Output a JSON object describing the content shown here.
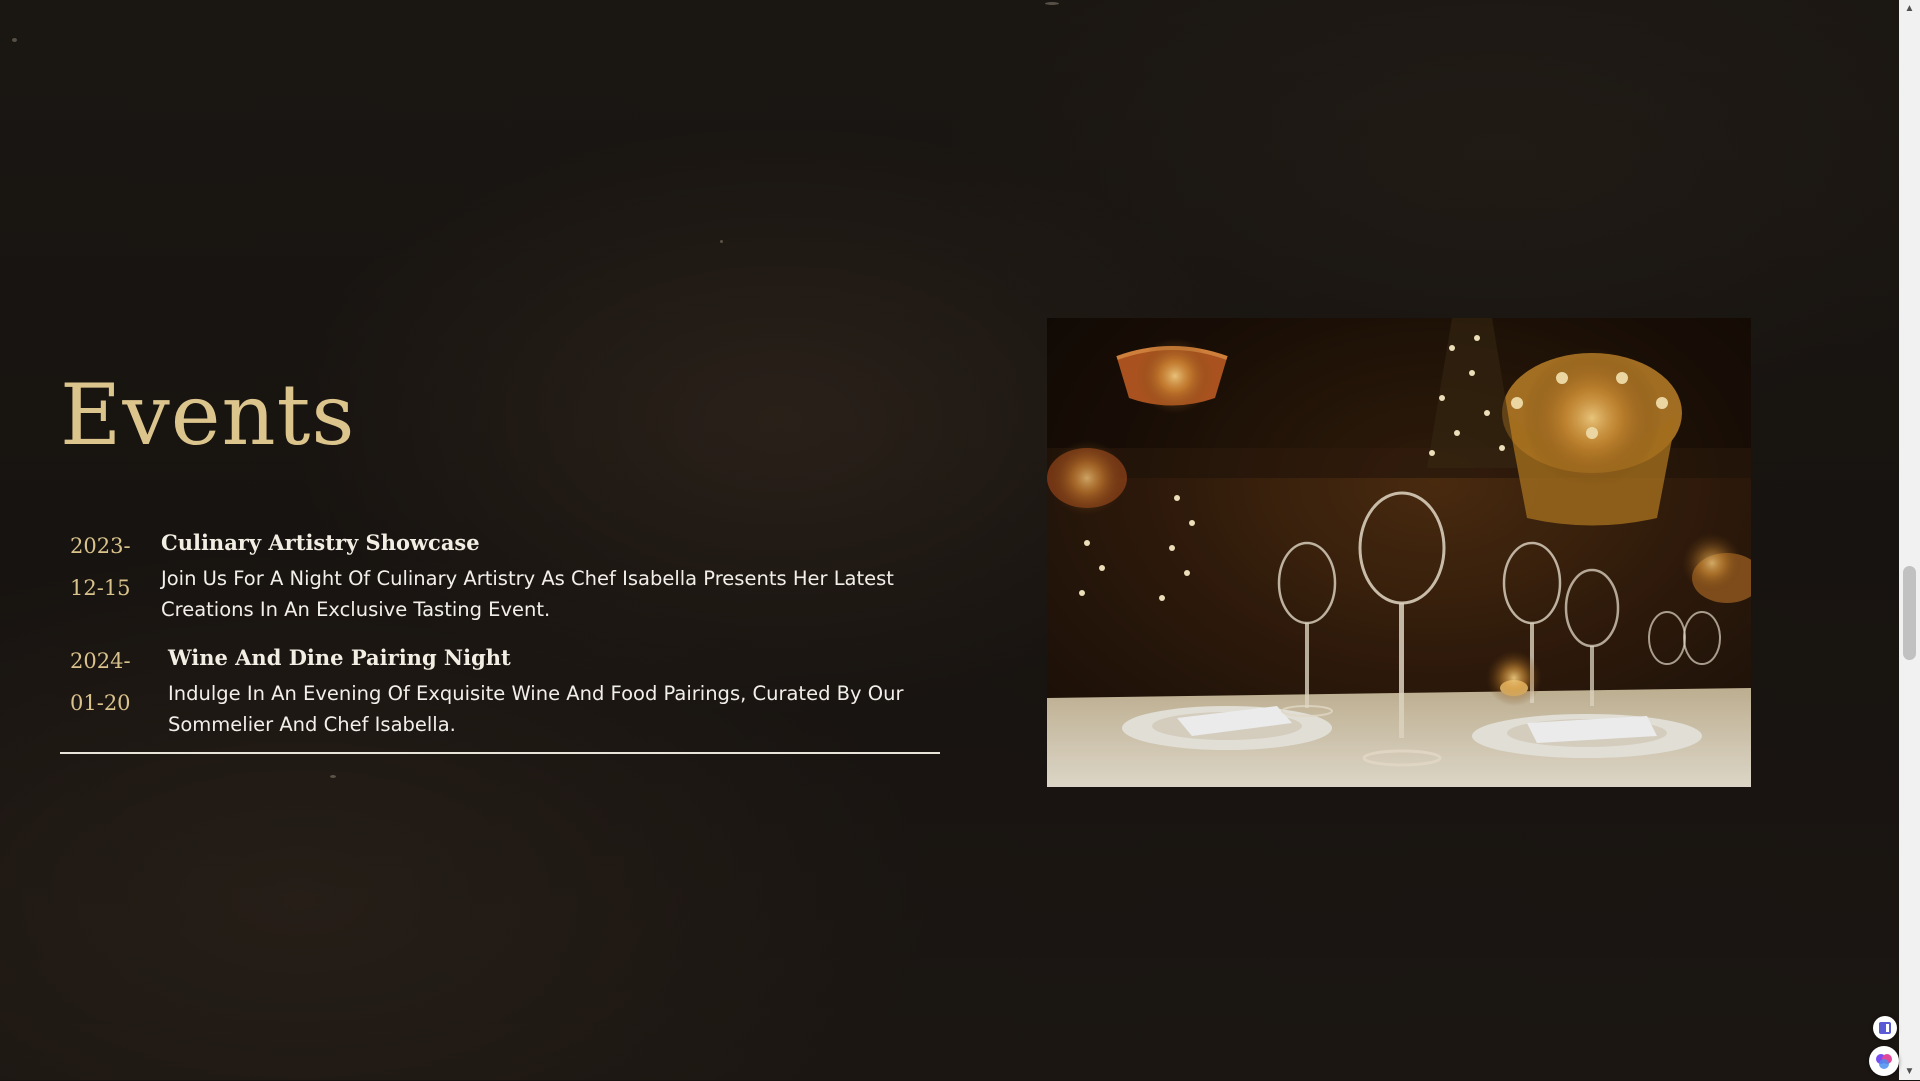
{
  "events_section": {
    "heading": "Events",
    "items": [
      {
        "date_part1": "2023-",
        "date_part2": "12-15",
        "title": "Culinary Artistry Showcase",
        "description": "Join Us For A Night Of Culinary Artistry As Chef Isabella Presents Her Latest Creations In An Exclusive Tasting Event."
      },
      {
        "date_part1": "2024-",
        "date_part2": "01-20",
        "title": "Wine And Dine Pairing Night",
        "description": "Indulge In An Evening Of Exquisite Wine And Food Pairings, Curated By Our Sommelier And Chef Isabella."
      }
    ]
  },
  "photo": {
    "subject": "restaurant-table-setting-photo"
  },
  "scrollbar": {
    "up_arrow": "▲",
    "down_arrow": "▼"
  },
  "floating_widgets": [
    {
      "icon": "sidebar-panel-icon"
    },
    {
      "icon": "assistant-orb-icon"
    }
  ],
  "colors": {
    "background": "#171310",
    "accent_gold": "#dcc48d",
    "text_light": "#f2efe9",
    "divider": "#e9e4da"
  }
}
